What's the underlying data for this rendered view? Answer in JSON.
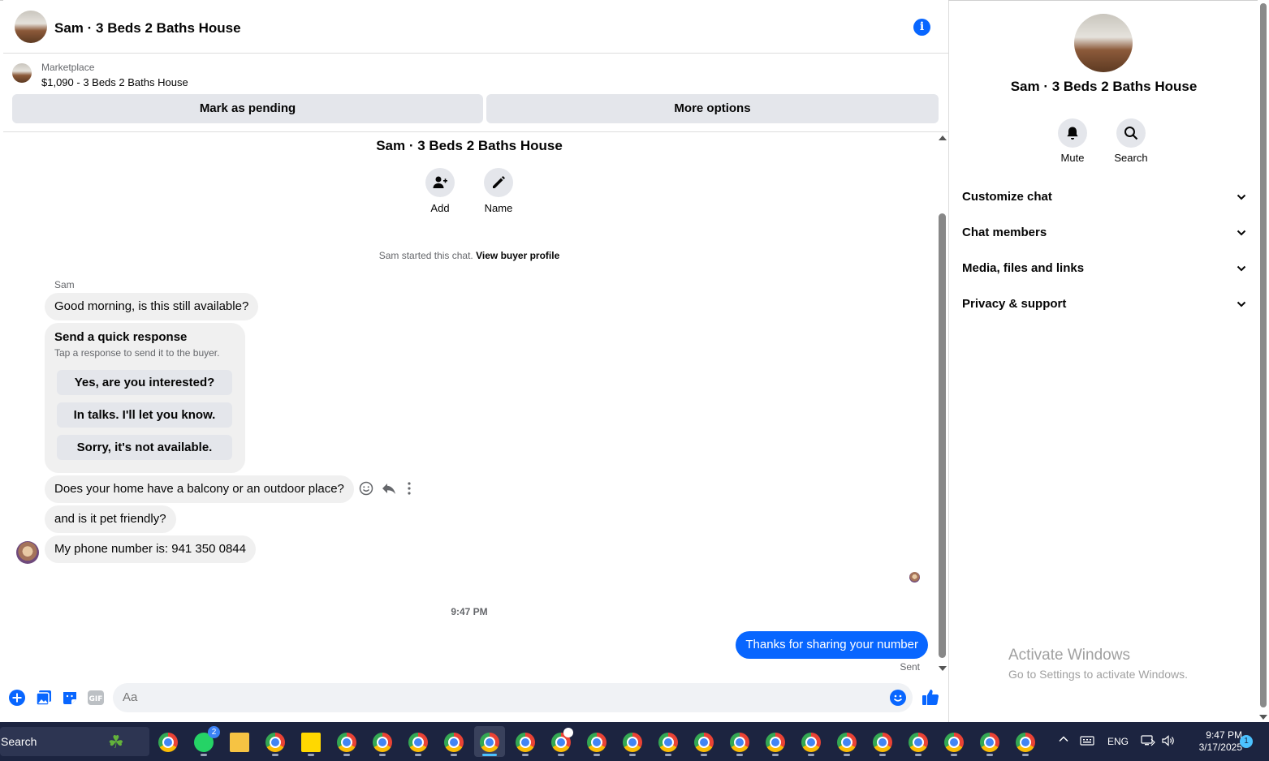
{
  "chat": {
    "title": "Sam · 3 Beds 2 Baths House",
    "listing": {
      "kicker": "Marketplace",
      "price_title": "$1,090 - 3 Beds 2 Baths House",
      "mark_pending_label": "Mark as pending",
      "more_options_label": "More options"
    },
    "intro": {
      "title": "Sam · 3 Beds 2 Baths House",
      "add_label": "Add",
      "name_label": "Name",
      "started_text": "Sam started this chat.",
      "view_profile_label": "View buyer profile"
    },
    "sender_name": "Sam",
    "messages": [
      "Good morning, is this still available?",
      "Does your home have a balcony or an outdoor place?",
      "and is it pet friendly?",
      "My phone number is: 941 350 0844"
    ],
    "quick_response": {
      "title": "Send a quick response",
      "subtitle": "Tap a response to send it to the buyer.",
      "options": [
        "Yes, are you interested?",
        "In talks. I'll let you know.",
        "Sorry, it's not available."
      ]
    },
    "time_separator": "9:47 PM",
    "own_message": "Thanks for sharing your number",
    "own_status": "Sent",
    "composer_placeholder": "Aa",
    "accent_color": "#0866ff"
  },
  "panel": {
    "title": "Sam · 3 Beds 2 Baths House",
    "mute_label": "Mute",
    "search_label": "Search",
    "sections": [
      "Customize chat",
      "Chat members",
      "Media, files and links",
      "Privacy & support"
    ]
  },
  "watermark": {
    "line1": "Activate Windows",
    "line2": "Go to Settings to activate Windows."
  },
  "taskbar": {
    "search_label": "Search",
    "whatsapp_badge": "2",
    "language": "ENG",
    "time": "9:47 PM",
    "date": "3/17/2025",
    "notification_count": "1"
  }
}
